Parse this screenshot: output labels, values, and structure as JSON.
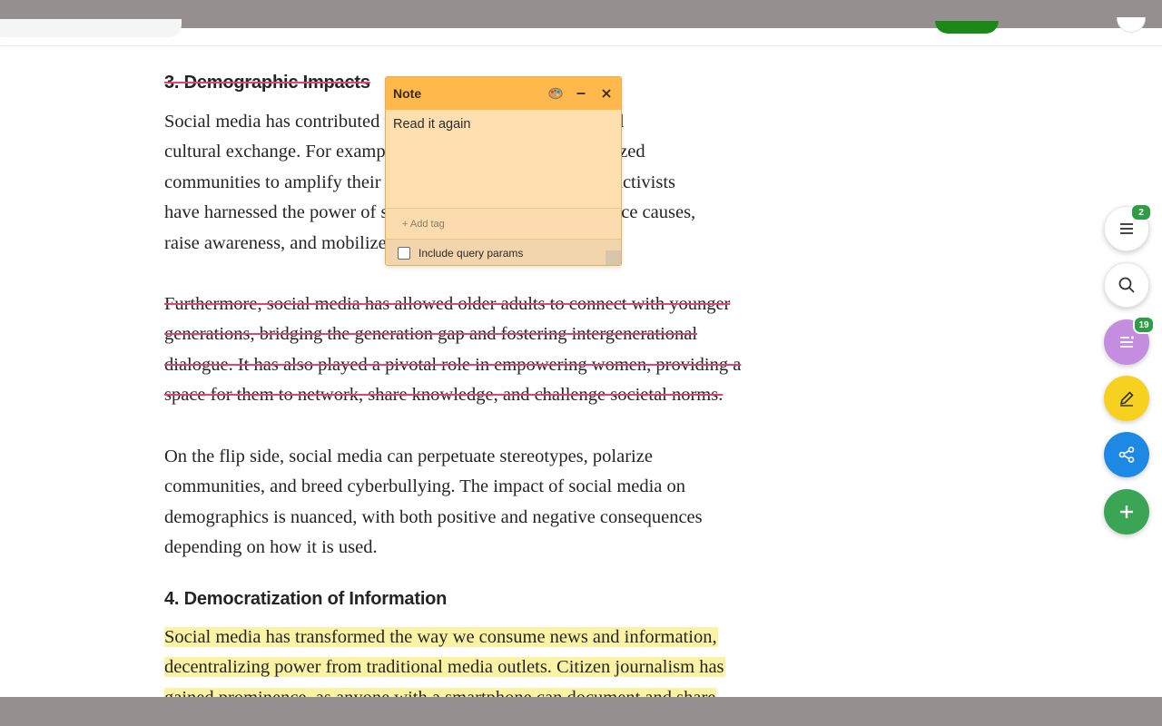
{
  "article": {
    "section3_heading": "3. Demographic Impacts",
    "para1_lines": [
      "Social media has contributed to the shift in demographics and",
      "cultural exchange. For example, it is a platform for marginalized",
      "communities to amplify their voices and share experiences. Activists",
      "have harnessed the power of social media to drive social justice causes,",
      "raise awareness, and mobilize communities."
    ],
    "para2_lines": [
      "Furthermore, social media has allowed older adults to connect with younger",
      "generations, bridging the generation gap and fostering intergenerational",
      "dialogue. It has also played a pivotal role in empowering women, providing a",
      "space for them to network, share knowledge, and challenge societal norms."
    ],
    "para3_lines": [
      "On the flip side, social media can perpetuate stereotypes, polarize",
      "communities, and breed cyberbullying. The impact of social media on",
      "demographics is nuanced, with both positive and negative consequences",
      "depending on how it is used."
    ],
    "section4_heading": "4. Democratization of Information",
    "para4_lines": [
      "Social media has transformed the way we consume news and information,",
      "decentralizing power from traditional media outlets. Citizen journalism has",
      "gained prominence, as anyone with a smartphone can document and share"
    ]
  },
  "note": {
    "title": "Note",
    "body": "Read it again",
    "add_tag": "+ Add tag",
    "include_query_params": "Include query params",
    "include_query_params_checked": false
  },
  "fabs": {
    "outline_badge": "2",
    "annotations_badge": "19"
  },
  "colors": {
    "note_header": "#ffb84b",
    "note_body": "#ffdfb0",
    "highlight": "#fbf3a3",
    "strike": "#e0457a",
    "fab_purple": "#c58de0",
    "fab_yellow": "#f7d11f",
    "fab_blue": "#1e88e5",
    "fab_green": "#3aa655",
    "badge_green": "#2e9e46"
  },
  "icons": [
    "palette-icon",
    "minimize-icon",
    "close-icon",
    "list-icon",
    "search-icon",
    "notes-list-icon",
    "pen-icon",
    "share-icon",
    "plus-icon"
  ]
}
